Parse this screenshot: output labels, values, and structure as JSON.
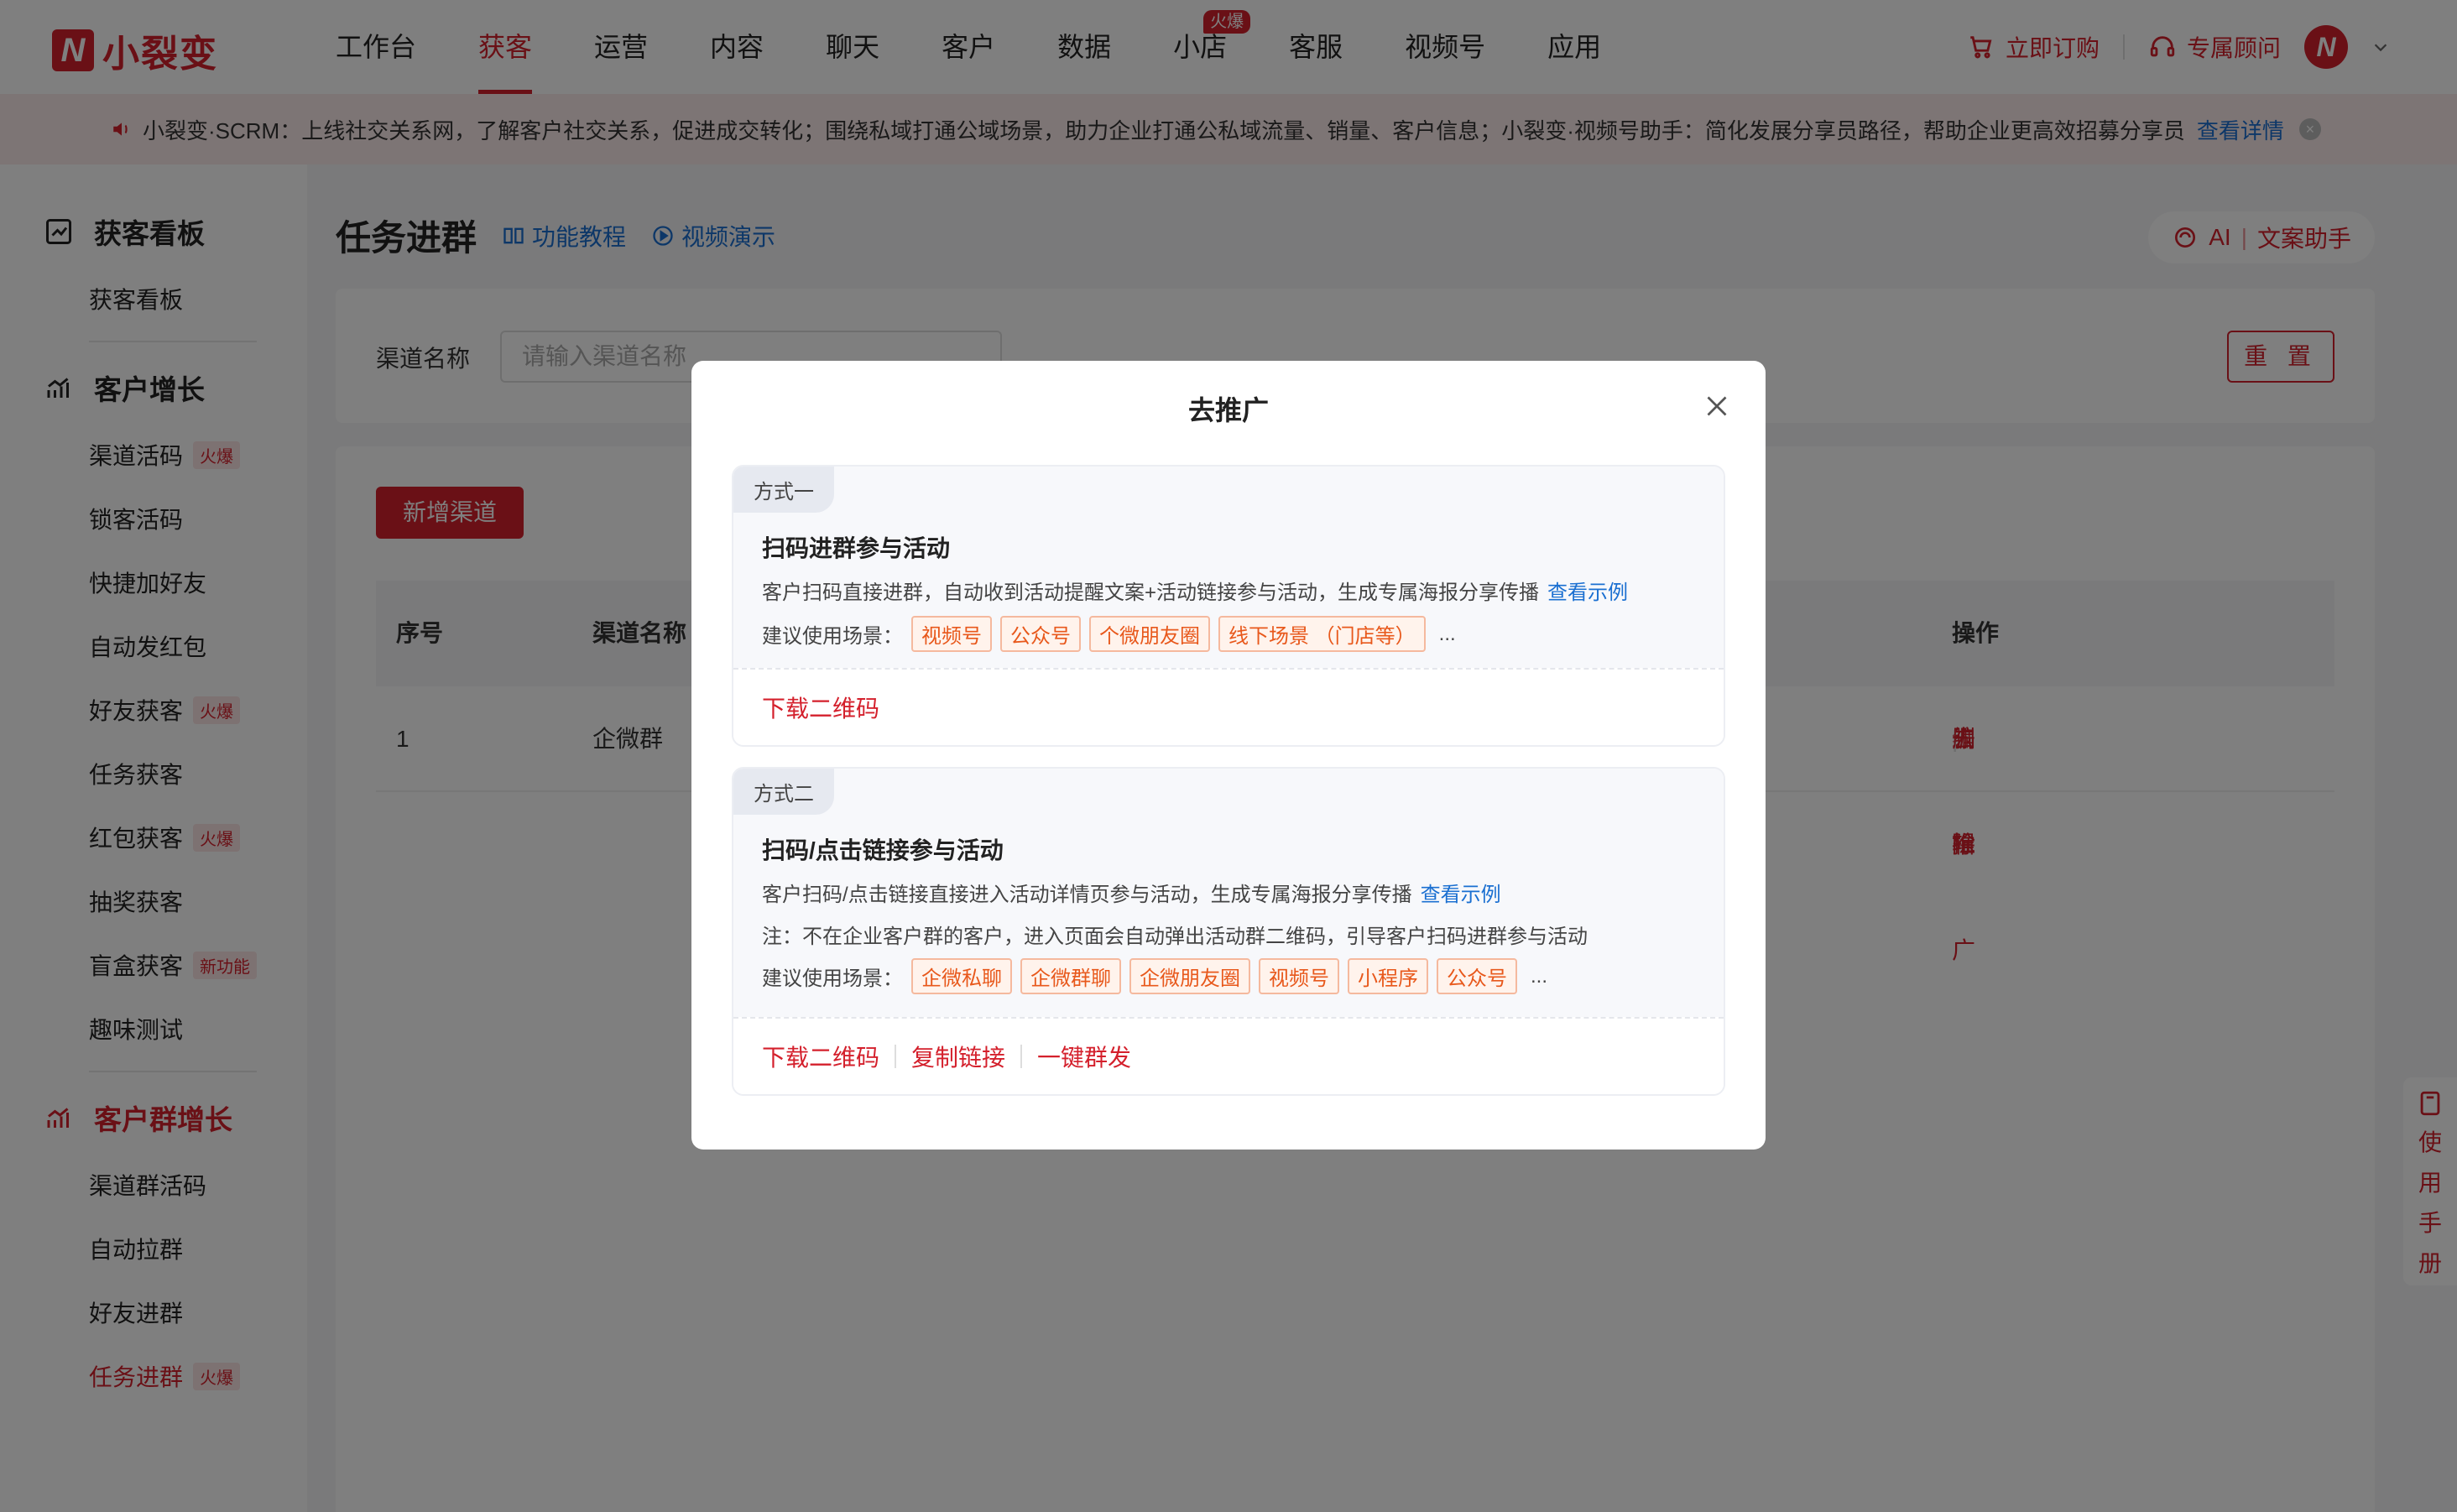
{
  "brand": {
    "logo_text": "小裂变",
    "logo_glyph": "N"
  },
  "nav": {
    "items": [
      {
        "label": "工作台",
        "active": false
      },
      {
        "label": "获客",
        "active": true
      },
      {
        "label": "运营",
        "active": false
      },
      {
        "label": "内容",
        "active": false
      },
      {
        "label": "聊天",
        "active": false
      },
      {
        "label": "客户",
        "active": false
      },
      {
        "label": "数据",
        "active": false
      },
      {
        "label": "小店",
        "active": false,
        "badge": "火爆"
      },
      {
        "label": "客服",
        "active": false
      },
      {
        "label": "视频号",
        "active": false
      },
      {
        "label": "应用",
        "active": false
      }
    ],
    "subscribe": "立即订购",
    "consultant": "专属顾问",
    "accent": "#d4202c"
  },
  "notice": {
    "text": "小裂变·SCRM：上线社交关系网，了解客户社交关系，促进成交转化；围绕私域打通公域场景，助力企业打通公私域流量、销量、客户信息；小裂变·视频号助手：简化发展分享员路径，帮助企业更高效招募分享员",
    "link": "查看详情"
  },
  "sidebar": {
    "groups": [
      {
        "title": "获客看板",
        "icon": "chart-line-icon",
        "active": false,
        "items": [
          {
            "label": "获客看板"
          }
        ]
      },
      {
        "title": "客户增长",
        "icon": "growth-chart-icon",
        "active": false,
        "items": [
          {
            "label": "渠道活码",
            "tag": "火爆"
          },
          {
            "label": "锁客活码"
          },
          {
            "label": "快捷加好友"
          },
          {
            "label": "自动发红包"
          },
          {
            "label": "好友获客",
            "tag": "火爆"
          },
          {
            "label": "任务获客"
          },
          {
            "label": "红包获客",
            "tag": "火爆"
          },
          {
            "label": "抽奖获客"
          },
          {
            "label": "盲盒获客",
            "tag": "新功能"
          },
          {
            "label": "趣味测试"
          }
        ]
      },
      {
        "title": "客户群增长",
        "icon": "growth-chart-icon",
        "active": true,
        "items": [
          {
            "label": "渠道群活码"
          },
          {
            "label": "自动拉群"
          },
          {
            "label": "好友进群"
          },
          {
            "label": "任务进群",
            "tag": "火爆",
            "active": true
          }
        ]
      }
    ]
  },
  "page": {
    "title": "任务进群",
    "tutorial": "功能教程",
    "video": "视频演示",
    "ai_label": "AI",
    "ai_assistant": "文案助手"
  },
  "filter": {
    "label": "渠道名称",
    "placeholder": "请输入渠道名称",
    "reset": "重 置"
  },
  "table": {
    "add_button": "新增渠道",
    "headers": [
      "序号",
      "渠道名称",
      "操作"
    ],
    "rows": [
      {
        "index": "1",
        "name": "企微群",
        "actions": [
          "去推广",
          "编辑",
          "删除"
        ]
      }
    ]
  },
  "manual": {
    "chars": [
      "使",
      "用",
      "手",
      "册"
    ]
  },
  "modal": {
    "title": "去推广",
    "method1": {
      "tag": "方式一",
      "name": "扫码进群参与活动",
      "desc": "客户扫码直接进群，自动收到活动提醒文案+活动链接参与活动，生成专属海报分享传播",
      "example": "查看示例",
      "scene_label": "建议使用场景：",
      "scenes": [
        "视频号",
        "公众号",
        "个微朋友圈",
        "线下场景 （门店等）"
      ],
      "ellipsis": "...",
      "actions": [
        "下载二维码"
      ]
    },
    "method2": {
      "tag": "方式二",
      "name": "扫码/点击链接参与活动",
      "desc": "客户扫码/点击链接直接进入活动详情页参与活动，生成专属海报分享传播",
      "example": "查看示例",
      "note": "注：不在企业客户群的客户，进入页面会自动弹出活动群二维码，引导客户扫码进群参与活动",
      "scene_label": "建议使用场景：",
      "scenes": [
        "企微私聊",
        "企微群聊",
        "企微朋友圈",
        "视频号",
        "小程序",
        "公众号"
      ],
      "ellipsis": "...",
      "actions": [
        "下载二维码",
        "复制链接",
        "一键群发"
      ]
    }
  }
}
